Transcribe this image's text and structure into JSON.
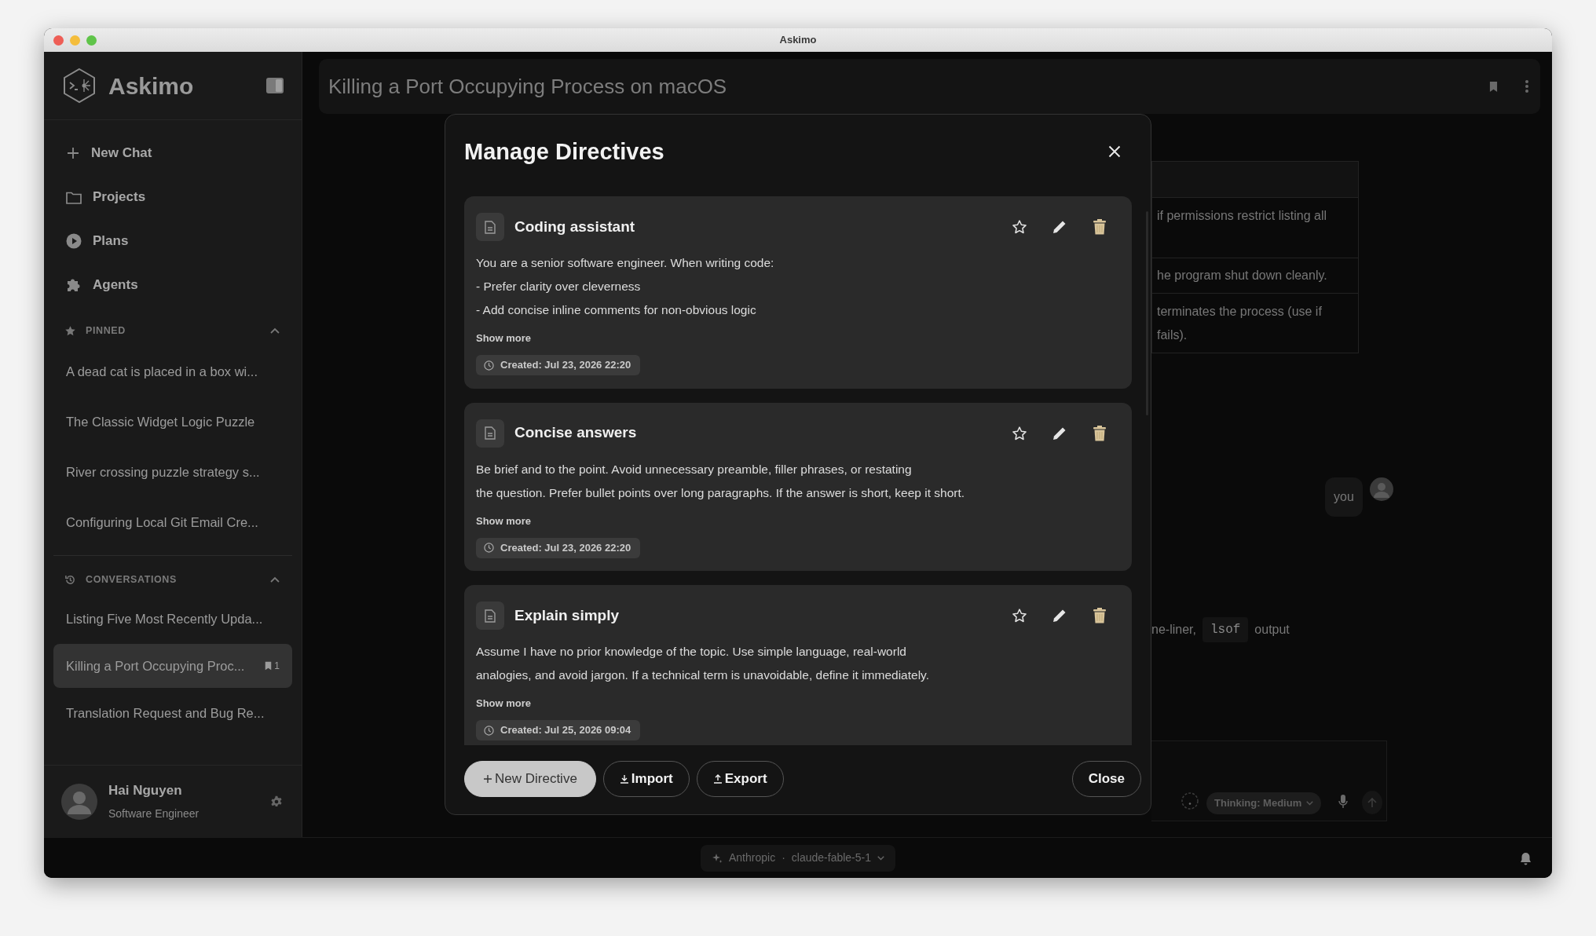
{
  "window": {
    "title": "Askimo"
  },
  "sidebar": {
    "app_name": "Askimo",
    "nav": [
      {
        "label": "New Chat"
      },
      {
        "label": "Projects"
      },
      {
        "label": "Plans"
      },
      {
        "label": "Agents"
      }
    ],
    "pinned": {
      "title": "PINNED",
      "expanded": true,
      "items": [
        {
          "title": "A dead cat is placed in a box wi..."
        },
        {
          "title": "The Classic Widget Logic Puzzle"
        },
        {
          "title": "River crossing puzzle strategy s..."
        },
        {
          "title": "Configuring Local Git Email Cre..."
        }
      ]
    },
    "conversations": {
      "title": "CONVERSATIONS",
      "expanded": true,
      "items": [
        {
          "title": "Listing Five Most Recently Upda...",
          "selected": false
        },
        {
          "title": "Killing a Port Occupying Proc...",
          "selected": true,
          "bookmark_count": "1"
        },
        {
          "title": "Translation Request and Bug Re...",
          "selected": false
        }
      ]
    },
    "user": {
      "name": "Hai Nguyen",
      "role": "Software Engineer"
    }
  },
  "chat": {
    "title": "Killing a Port Occupying Process on macOS",
    "table_rows": [
      {
        "lines": []
      },
      {
        "lines": [
          "if permissions restrict listing all"
        ]
      },
      {
        "lines": [
          "he program shut down cleanly."
        ]
      },
      {
        "lines": [
          "terminates the process (use if",
          "fails)."
        ]
      }
    ],
    "user_message": "you",
    "text_fragment": [
      {
        "kind": "text",
        "text": "ne-liner,"
      },
      {
        "kind": "code",
        "text": "lsof"
      },
      {
        "kind": "text",
        "text": "output"
      }
    ],
    "composer": {
      "thinking": "Thinking: Medium"
    }
  },
  "footer": {
    "provider": "Anthropic",
    "separator": "·",
    "model": "claude-fable-5-1"
  },
  "dialog": {
    "title": "Manage Directives",
    "directives": [
      {
        "name": "Coding assistant",
        "starred": false,
        "lines": [
          "You are a senior software engineer. When writing code:",
          "- Prefer clarity over cleverness",
          "- Add concise inline comments for non-obvious logic"
        ],
        "show_more": "Show more",
        "created": "Created: Jul 23, 2026 22:20"
      },
      {
        "name": "Concise answers",
        "starred": false,
        "lines": [
          "Be brief and to the point. Avoid unnecessary preamble, filler phrases, or restating",
          "the question. Prefer bullet points over long paragraphs. If the answer is short, keep it short."
        ],
        "show_more": "Show more",
        "created": "Created: Jul 23, 2026 22:20"
      },
      {
        "name": "Explain simply",
        "starred": false,
        "lines": [
          "Assume I have no prior knowledge of the topic. Use simple language, real-world",
          "analogies, and avoid jargon. If a technical term is unavoidable, define it immediately."
        ],
        "show_more": "Show more",
        "created": "Created: Jul 25, 2026 09:04"
      }
    ],
    "actions": [
      {
        "label": "New Directive",
        "kind": "add"
      },
      {
        "label": "Import",
        "kind": "import"
      },
      {
        "label": "Export",
        "kind": "export"
      }
    ],
    "close_button": "Close"
  }
}
